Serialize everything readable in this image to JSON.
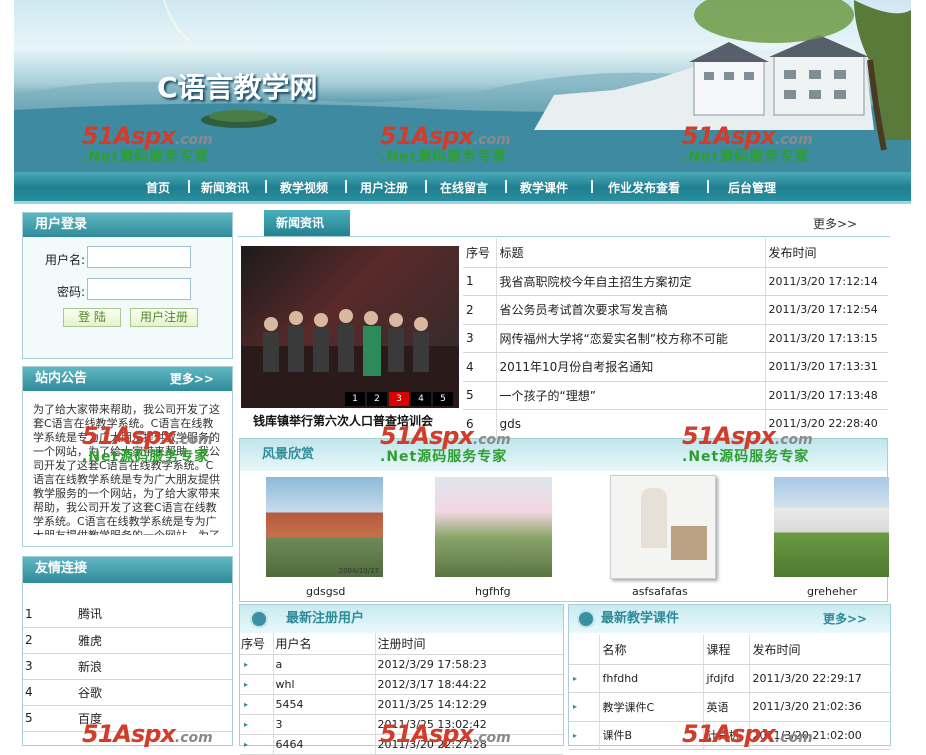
{
  "site": {
    "title": "C语言教学网"
  },
  "nav": [
    "首页",
    "新闻资讯",
    "教学视频",
    "用户注册",
    "在线留言",
    "教学课件",
    "作业发布查看",
    "后台管理"
  ],
  "login": {
    "title": "用户登录",
    "username_label": "用户名:",
    "password_label": "密码:",
    "login_button": "登 陆",
    "register_button": "用户注册"
  },
  "notice": {
    "title": "站内公告",
    "more": "更多>>",
    "text": "为了给大家带来帮助，我公司开发了这套C语言在线教学系统。C语言在线教学系统是专为广大朋友提供教学服务的一个网站，为了给大家带来帮助，我公司开发了这套C语言在线教学系统。C语言在线教学系统是专为广大朋友提供教学服务的一个网站，为了给大家带来帮助，我公司开发了这套C语言在线教学系统。C语言在线教学系统是专为广大朋友提供教学服务的一个网站，为了给大家带来帮助，我公司开发了这套C语言在线"
  },
  "links": {
    "title": "友情连接",
    "items": [
      {
        "num": "1",
        "name": "腾讯"
      },
      {
        "num": "2",
        "name": "雅虎"
      },
      {
        "num": "3",
        "name": "新浪"
      },
      {
        "num": "4",
        "name": "谷歌"
      },
      {
        "num": "5",
        "name": "百度"
      }
    ]
  },
  "news": {
    "title": "新闻资讯",
    "more": "更多>>",
    "caption": "钱库镇举行第六次人口普查培训会",
    "slide_pages": [
      "1",
      "2",
      "3",
      "4",
      "5"
    ],
    "active_page": "3",
    "headers": [
      "序号",
      "标题",
      "发布时间"
    ],
    "rows": [
      [
        "1",
        "我省高职院校今年自主招生方案初定",
        "2011/3/20 17:12:14"
      ],
      [
        "2",
        "省公务员考试首次要求写发言稿",
        "2011/3/20 17:12:54"
      ],
      [
        "3",
        "网传福州大学将“恋爱实名制”校方称不可能",
        "2011/3/20 17:13:15"
      ],
      [
        "4",
        "2011年10月份自考报名通知",
        "2011/3/20 17:13:31"
      ],
      [
        "5",
        "一个孩子的“理想”",
        "2011/3/20 17:13:48"
      ],
      [
        "6",
        "gds",
        "2011/3/20 22:28:40"
      ]
    ]
  },
  "scenery": {
    "title": "风景欣赏",
    "photo_date": "2004/10/27",
    "items": [
      "gdsgsd",
      "hgfhfg",
      "asfsafafas",
      "greheher"
    ]
  },
  "users": {
    "title": "最新注册用户",
    "headers": [
      "序号",
      "用户名",
      "注册时间"
    ],
    "rows": [
      [
        "a",
        "2012/3/29 17:58:23"
      ],
      [
        "whl",
        "2012/3/17 18:44:22"
      ],
      [
        "5454",
        "2011/3/25 14:12:29"
      ],
      [
        "3",
        "2011/3/25 13:02:42"
      ],
      [
        "6464",
        "2011/3/20 22:27:28"
      ]
    ]
  },
  "courses": {
    "title": "最新教学课件",
    "more": "更多>>",
    "headers": [
      "名称",
      "课程",
      "发布时间"
    ],
    "rows": [
      [
        "fhfdhd",
        "jfdjfd",
        "2011/3/20 22:29:17"
      ],
      [
        "教学课件C",
        "英语",
        "2011/3/20 21:02:36"
      ],
      [
        "课件B",
        "计算机",
        "2011/3/20 21:02:00"
      ]
    ]
  },
  "watermark": {
    "brand": "51Aspx",
    "domain": ".com",
    "slogan": ".Net源码服务专家"
  },
  "colors": {
    "teal": "#2f8b9a",
    "nav_light": "#4aa9b7",
    "red_watermark": "#d23c2b",
    "green_watermark": "#2e9e33"
  }
}
